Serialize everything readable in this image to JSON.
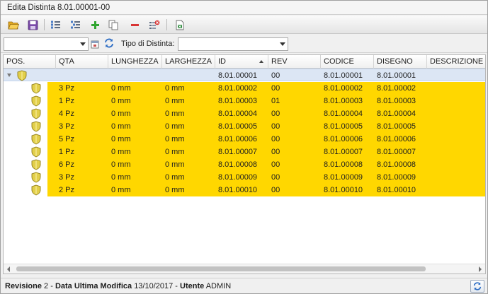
{
  "window": {
    "title": "Edita Distinta 8.01.00001-00"
  },
  "toolbar": {
    "buttons": [
      {
        "name": "open-folder-icon"
      },
      {
        "name": "save-icon"
      },
      {
        "name": "list-view-icon"
      },
      {
        "name": "list-indent-icon"
      },
      {
        "name": "add-icon"
      },
      {
        "name": "copy-icon"
      },
      {
        "name": "remove-icon"
      },
      {
        "name": "delete-list-icon"
      },
      {
        "name": "export-excel-icon"
      }
    ]
  },
  "filter": {
    "first_combo_value": "",
    "tipo_label": "Tipo di Distinta:",
    "tipo_value": ""
  },
  "grid": {
    "columns": [
      "POS.",
      "QTA",
      "LUNGHEZZA",
      "LARGHEZZA",
      "ID",
      "REV",
      "CODICE",
      "DISEGNO",
      "DESCRIZIONE"
    ],
    "sorted_column": "ID",
    "root": {
      "qta": "",
      "lunghezza": "",
      "larghezza": "",
      "id": "8.01.00001",
      "rev": "00",
      "codice": "8.01.00001",
      "disegno": "8.01.00001",
      "descrizione": ""
    },
    "rows": [
      {
        "qta": "3 Pz",
        "lunghezza": "0 mm",
        "larghezza": "0 mm",
        "id": "8.01.00002",
        "rev": "00",
        "codice": "8.01.00002",
        "disegno": "8.01.00002",
        "descrizione": ""
      },
      {
        "qta": "1 Pz",
        "lunghezza": "0 mm",
        "larghezza": "0 mm",
        "id": "8.01.00003",
        "rev": "01",
        "codice": "8.01.00003",
        "disegno": "8.01.00003",
        "descrizione": ""
      },
      {
        "qta": "4 Pz",
        "lunghezza": "0 mm",
        "larghezza": "0 mm",
        "id": "8.01.00004",
        "rev": "00",
        "codice": "8.01.00004",
        "disegno": "8.01.00004",
        "descrizione": ""
      },
      {
        "qta": "3 Pz",
        "lunghezza": "0 mm",
        "larghezza": "0 mm",
        "id": "8.01.00005",
        "rev": "00",
        "codice": "8.01.00005",
        "disegno": "8.01.00005",
        "descrizione": ""
      },
      {
        "qta": "5 Pz",
        "lunghezza": "0 mm",
        "larghezza": "0 mm",
        "id": "8.01.00006",
        "rev": "00",
        "codice": "8.01.00006",
        "disegno": "8.01.00006",
        "descrizione": ""
      },
      {
        "qta": "1 Pz",
        "lunghezza": "0 mm",
        "larghezza": "0 mm",
        "id": "8.01.00007",
        "rev": "00",
        "codice": "8.01.00007",
        "disegno": "8.01.00007",
        "descrizione": ""
      },
      {
        "qta": "6 Pz",
        "lunghezza": "0 mm",
        "larghezza": "0 mm",
        "id": "8.01.00008",
        "rev": "00",
        "codice": "8.01.00008",
        "disegno": "8.01.00008",
        "descrizione": ""
      },
      {
        "qta": "3 Pz",
        "lunghezza": "0 mm",
        "larghezza": "0 mm",
        "id": "8.01.00009",
        "rev": "00",
        "codice": "8.01.00009",
        "disegno": "8.01.00009",
        "descrizione": ""
      },
      {
        "qta": "2 Pz",
        "lunghezza": "0 mm",
        "larghezza": "0 mm",
        "id": "8.01.00010",
        "rev": "00",
        "codice": "8.01.00010",
        "disegno": "8.01.00010",
        "descrizione": ""
      }
    ],
    "colors": {
      "row_highlight": "#ffd700",
      "root_selected": "#dce6f4"
    }
  },
  "status": {
    "revisione_label": "Revisione",
    "revisione_value": "2",
    "sep1": " - ",
    "data_label": "Data Ultima Modifica",
    "data_value": "13/10/2017",
    "sep2": " - ",
    "utente_label": "Utente",
    "utente_value": "ADMIN"
  }
}
